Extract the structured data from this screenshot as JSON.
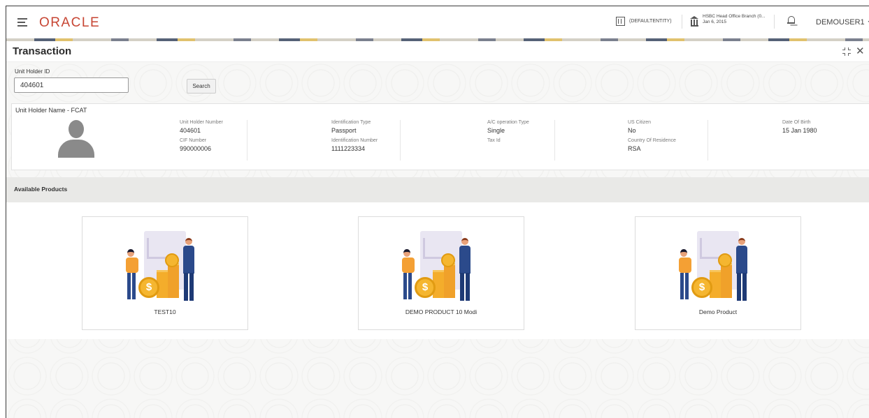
{
  "header": {
    "logo": "ORACLE",
    "entity": "(DEFAULTENTITY)",
    "branch_name": "HSBC Head Office Branch (0...",
    "branch_date": "Jan 6, 2015",
    "user": "DEMOUSER1"
  },
  "page": {
    "title": "Transaction"
  },
  "search": {
    "label": "Unit Holder ID",
    "value": "404601",
    "button": "Search"
  },
  "holder": {
    "name": "Unit Holder Name - FCAT",
    "fields": {
      "unit_holder_number": {
        "label": "Unit Holder Number",
        "value": "404601"
      },
      "cif_number": {
        "label": "CIF Number",
        "value": "990000006"
      },
      "identification_type": {
        "label": "Identification Type",
        "value": "Passport"
      },
      "identification_number": {
        "label": "Identification Number",
        "value": "1111223334"
      },
      "ac_operation_type": {
        "label": "A/C operation Type",
        "value": "Single"
      },
      "tax_id": {
        "label": "Tax Id",
        "value": ""
      },
      "us_citizen": {
        "label": "US Citizen",
        "value": "No"
      },
      "country_of_residence": {
        "label": "Country Of Residence",
        "value": "RSA"
      },
      "date_of_birth": {
        "label": "Date Of Birth",
        "value": "15 Jan 1980"
      }
    }
  },
  "products": {
    "title": "Available Products",
    "items": [
      {
        "name": "TEST10"
      },
      {
        "name": "DEMO PRODUCT 10 Modi"
      },
      {
        "name": "Demo Product"
      }
    ]
  },
  "colors": {
    "brand": "#c74634",
    "accent_bar": "#e9e9e7"
  }
}
